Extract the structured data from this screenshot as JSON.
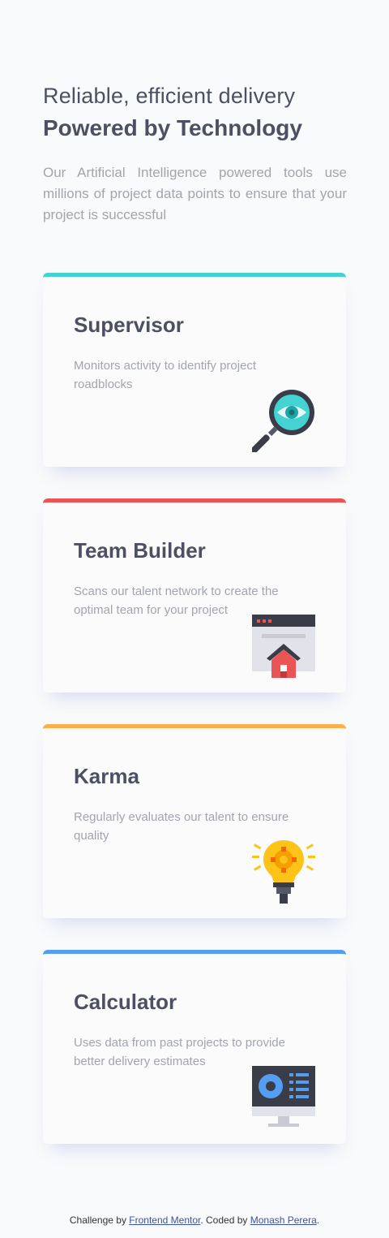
{
  "header": {
    "subtitle": "Reliable, efficient delivery",
    "title": "Powered by Technology",
    "description": "Our Artificial Intelligence powered tools use millions of project data points to ensure that your project is successful"
  },
  "cards": [
    {
      "title": "Supervisor",
      "description": "Monitors activity to identify project roadblocks",
      "accent": "#44d3d2",
      "icon": "magnifier-eye-icon"
    },
    {
      "title": "Team Builder",
      "description": "Scans our talent network to create the optimal team for your project",
      "accent": "#ea5454",
      "icon": "team-builder-window-icon"
    },
    {
      "title": "Karma",
      "description": "Regularly evaluates our talent to ensure quality",
      "accent": "#fcaf4a",
      "icon": "lightbulb-icon"
    },
    {
      "title": "Calculator",
      "description": "Uses data from past projects to provide better delivery estimates",
      "accent": "#549ef2",
      "icon": "monitor-calculator-icon"
    }
  ],
  "footer": {
    "prefix": "Challenge by ",
    "link1": "Frontend Mentor",
    "middle": ". Coded by ",
    "link2": "Monash Perera",
    "suffix": "."
  }
}
